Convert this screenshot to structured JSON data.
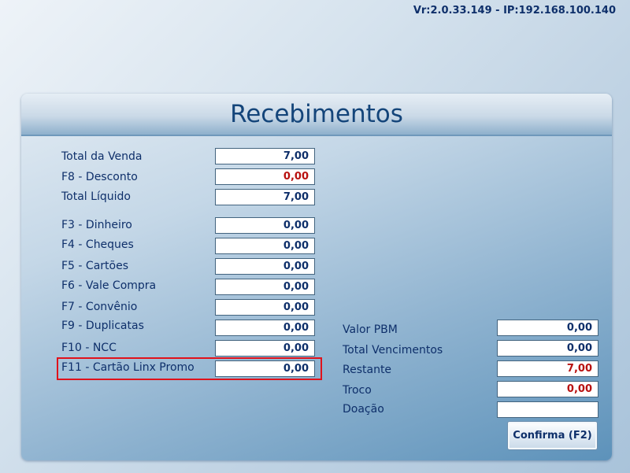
{
  "header": {
    "version": "Vr:2.0.33.149 - IP:192.168.100.140"
  },
  "title": "Recebimentos",
  "totals": [
    {
      "label": "Total da Venda",
      "value": "7,00"
    },
    {
      "label": "F8 - Desconto",
      "value": "0,00"
    },
    {
      "label": "Total Líquido",
      "value": "7,00"
    }
  ],
  "payments": [
    {
      "label": "F3 - Dinheiro",
      "value": "0,00"
    },
    {
      "label": "F4 - Cheques",
      "value": "0,00"
    },
    {
      "label": "F5 - Cartões",
      "value": "0,00"
    },
    {
      "label": "F6 - Vale Compra",
      "value": "0,00"
    },
    {
      "label": "F7 - Convênio",
      "value": "0,00"
    },
    {
      "label": "F9 - Duplicatas",
      "value": "0,00"
    },
    {
      "label": "F10 - NCC",
      "value": "0,00"
    },
    {
      "label": "F11 - Cartão Linx Promo",
      "value": "0,00"
    }
  ],
  "summary": [
    {
      "label": "Valor PBM",
      "value": "0,00"
    },
    {
      "label": "Total Vencimentos",
      "value": "0,00"
    },
    {
      "label": "Restante",
      "value": "7,00"
    },
    {
      "label": "Troco",
      "value": "0,00"
    },
    {
      "label": "Doação",
      "value": ""
    }
  ],
  "confirm_label": "Confirma (F2)",
  "colors": {
    "label": "#0e2f6a",
    "alert": "#b8100f",
    "highlight": "#e0121b"
  }
}
